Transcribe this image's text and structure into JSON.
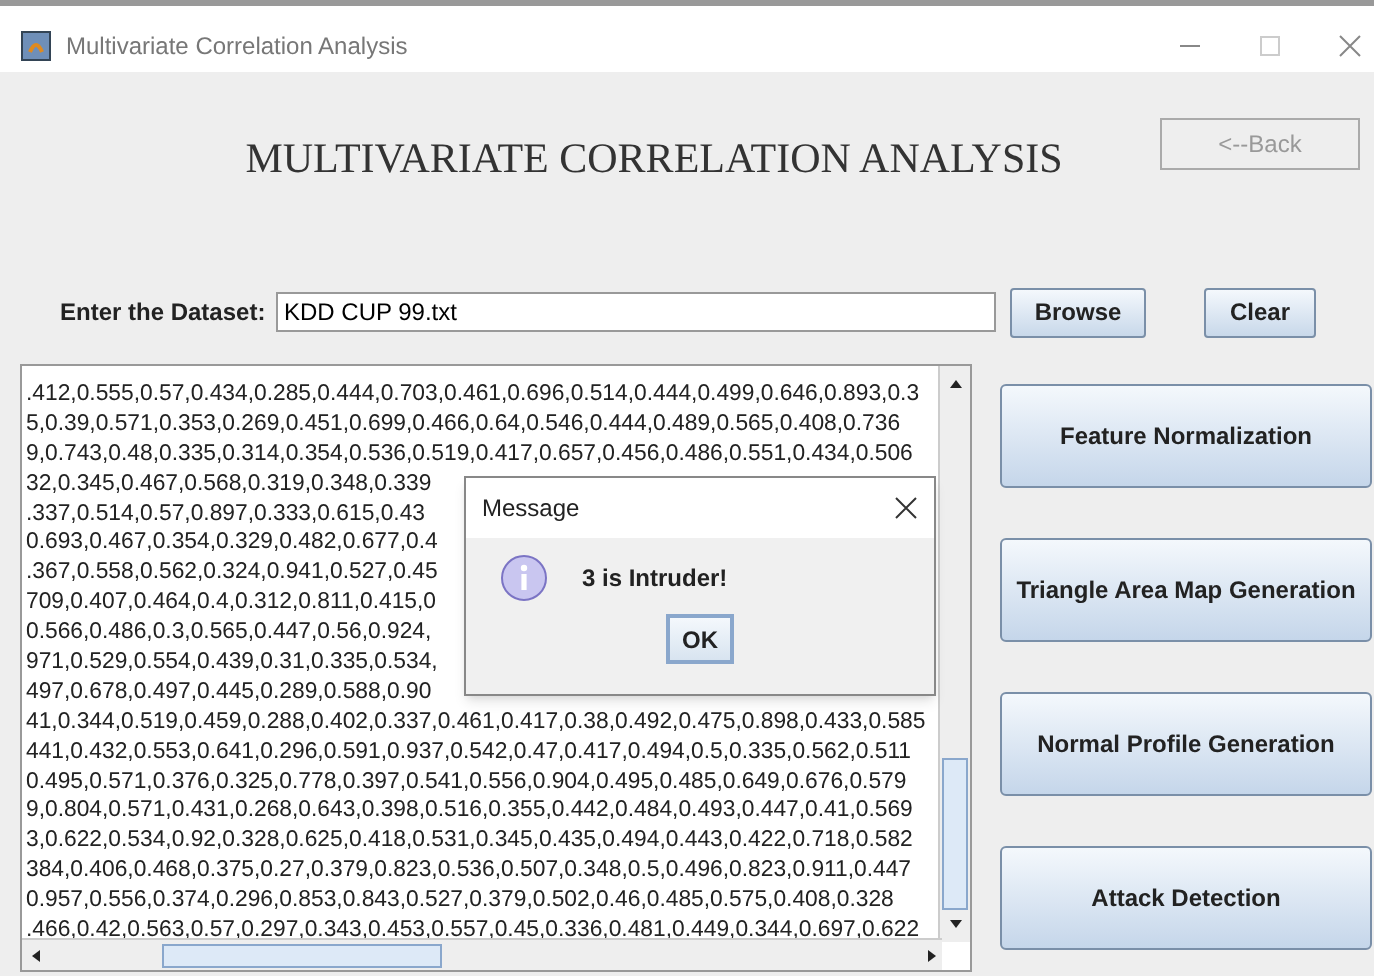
{
  "window": {
    "title": "Multivariate Correlation Analysis"
  },
  "heading": "MULTIVARIATE CORRELATION ANALYSIS",
  "back_button": {
    "label": "<--Back",
    "disabled": true
  },
  "dataset": {
    "label": "Enter the Dataset:",
    "value": "KDD CUP 99.txt"
  },
  "dataset_buttons": [
    "Browse",
    "Clear"
  ],
  "data_lines": [
    ".412,0.555,0.57,0.434,0.285,0.444,0.703,0.461,0.696,0.514,0.444,0.499,0.646,0.893,0.3",
    "5,0.39,0.571,0.353,0.269,0.451,0.699,0.466,0.64,0.546,0.444,0.489,0.565,0.408,0.736",
    "9,0.743,0.48,0.335,0.314,0.354,0.536,0.519,0.417,0.657,0.456,0.486,0.551,0.434,0.506",
    "32,0.345,0.467,0.568,0.319,0.348,0.339",
    ".337,0.514,0.57,0.897,0.333,0.615,0.43",
    "0.693,0.467,0.354,0.329,0.482,0.677,0.4",
    ".367,0.558,0.562,0.324,0.941,0.527,0.45",
    "709,0.407,0.464,0.4,0.312,0.811,0.415,0",
    "0.566,0.486,0.3,0.565,0.447,0.56,0.924,",
    "971,0.529,0.554,0.439,0.31,0.335,0.534,",
    "497,0.678,0.497,0.445,0.289,0.588,0.90",
    "41,0.344,0.519,0.459,0.288,0.402,0.337,0.461,0.417,0.38,0.492,0.475,0.898,0.433,0.585",
    "441,0.432,0.553,0.641,0.296,0.591,0.937,0.542,0.47,0.417,0.494,0.5,0.335,0.562,0.511",
    "0.495,0.571,0.376,0.325,0.778,0.397,0.541,0.556,0.904,0.495,0.485,0.649,0.676,0.579",
    "9,0.804,0.571,0.431,0.268,0.643,0.398,0.516,0.355,0.442,0.484,0.493,0.447,0.41,0.569",
    "3,0.622,0.534,0.92,0.328,0.625,0.418,0.531,0.345,0.435,0.494,0.443,0.422,0.718,0.582",
    "384,0.406,0.468,0.375,0.27,0.379,0.823,0.536,0.507,0.348,0.5,0.496,0.823,0.911,0.447",
    "0.957,0.556,0.374,0.296,0.853,0.843,0.527,0.379,0.502,0.46,0.485,0.575,0.408,0.328",
    ".466,0.42,0.563,0.57,0.297,0.343,0.453,0.557,0.45,0.336,0.481,0.449,0.344,0.697,0.622"
  ],
  "actions": [
    "Feature Normalization",
    "Triangle Area Map Generation",
    "Normal Profile Generation",
    "Attack Detection"
  ],
  "dialog": {
    "title": "Message",
    "message": "3 is Intruder!",
    "button": "OK"
  }
}
